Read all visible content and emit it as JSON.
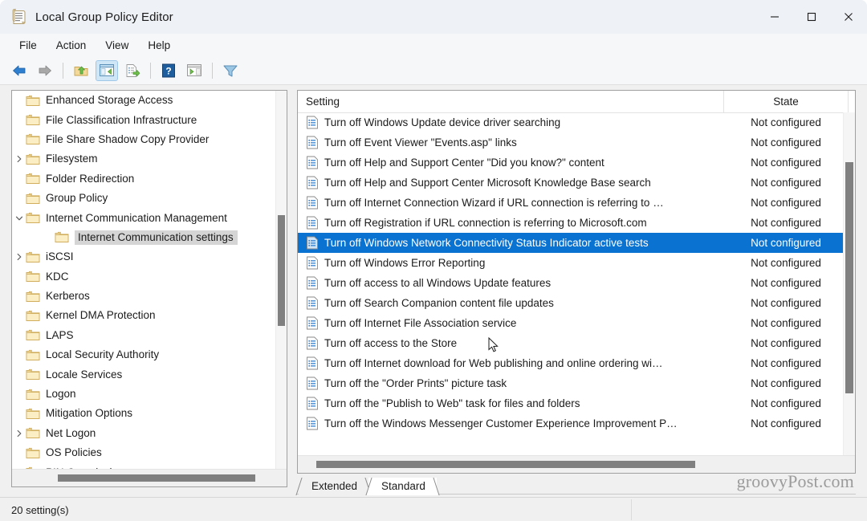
{
  "window": {
    "title": "Local Group Policy Editor",
    "icon": "policy-scroll-icon",
    "controls": {
      "minimize": "─",
      "maximize": "☐",
      "close": "✕"
    }
  },
  "menubar": {
    "items": [
      "File",
      "Action",
      "View",
      "Help"
    ]
  },
  "toolbar": {
    "buttons": [
      {
        "name": "back-icon"
      },
      {
        "name": "forward-icon"
      },
      {
        "sep": true
      },
      {
        "name": "up-one-level-icon"
      },
      {
        "name": "show-hide-console-tree-icon",
        "active": true
      },
      {
        "name": "export-list-icon"
      },
      {
        "sep": true
      },
      {
        "name": "help-icon"
      },
      {
        "name": "show-hide-action-pane-icon"
      },
      {
        "sep": true
      },
      {
        "name": "filter-icon"
      }
    ]
  },
  "tree": {
    "nodes": [
      {
        "label": "Enhanced Storage Access",
        "depth": 1,
        "chevron": "none"
      },
      {
        "label": "File Classification Infrastructure",
        "depth": 1,
        "chevron": "none"
      },
      {
        "label": "File Share Shadow Copy Provider",
        "depth": 1,
        "chevron": "none"
      },
      {
        "label": "Filesystem",
        "depth": 1,
        "chevron": "collapsed"
      },
      {
        "label": "Folder Redirection",
        "depth": 1,
        "chevron": "none"
      },
      {
        "label": "Group Policy",
        "depth": 1,
        "chevron": "none"
      },
      {
        "label": "Internet Communication Management",
        "depth": 1,
        "chevron": "expanded"
      },
      {
        "label": "Internet Communication settings",
        "depth": 2,
        "chevron": "none",
        "selected": true
      },
      {
        "label": "iSCSI",
        "depth": 1,
        "chevron": "collapsed"
      },
      {
        "label": "KDC",
        "depth": 1,
        "chevron": "none"
      },
      {
        "label": "Kerberos",
        "depth": 1,
        "chevron": "none"
      },
      {
        "label": "Kernel DMA Protection",
        "depth": 1,
        "chevron": "none"
      },
      {
        "label": "LAPS",
        "depth": 1,
        "chevron": "none"
      },
      {
        "label": "Local Security Authority",
        "depth": 1,
        "chevron": "none"
      },
      {
        "label": "Locale Services",
        "depth": 1,
        "chevron": "none"
      },
      {
        "label": "Logon",
        "depth": 1,
        "chevron": "none"
      },
      {
        "label": "Mitigation Options",
        "depth": 1,
        "chevron": "none"
      },
      {
        "label": "Net Logon",
        "depth": 1,
        "chevron": "collapsed"
      },
      {
        "label": "OS Policies",
        "depth": 1,
        "chevron": "none"
      },
      {
        "label": "PIN Complexity",
        "depth": 1,
        "chevron": "none"
      }
    ]
  },
  "list": {
    "columns": {
      "setting": "Setting",
      "state": "State"
    },
    "rows": [
      {
        "setting": "Turn off Windows Update device driver searching",
        "state": "Not configured"
      },
      {
        "setting": "Turn off Event Viewer \"Events.asp\" links",
        "state": "Not configured"
      },
      {
        "setting": "Turn off Help and Support Center \"Did you know?\" content",
        "state": "Not configured"
      },
      {
        "setting": "Turn off Help and Support Center Microsoft Knowledge Base search",
        "state": "Not configured"
      },
      {
        "setting": "Turn off Internet Connection Wizard if URL connection is referring to …",
        "state": "Not configured"
      },
      {
        "setting": "Turn off Registration if URL connection is referring to Microsoft.com",
        "state": "Not configured"
      },
      {
        "setting": "Turn off Windows Network Connectivity Status Indicator active tests",
        "state": "Not configured",
        "selected": true
      },
      {
        "setting": "Turn off Windows Error Reporting",
        "state": "Not configured"
      },
      {
        "setting": "Turn off access to all Windows Update features",
        "state": "Not configured"
      },
      {
        "setting": "Turn off Search Companion content file updates",
        "state": "Not configured"
      },
      {
        "setting": "Turn off Internet File Association service",
        "state": "Not configured"
      },
      {
        "setting": "Turn off access to the Store",
        "state": "Not configured"
      },
      {
        "setting": "Turn off Internet download for Web publishing and online ordering wi…",
        "state": "Not configured"
      },
      {
        "setting": "Turn off the \"Order Prints\" picture task",
        "state": "Not configured"
      },
      {
        "setting": "Turn off the \"Publish to Web\" task for files and folders",
        "state": "Not configured"
      },
      {
        "setting": "Turn off the Windows Messenger Customer Experience Improvement P…",
        "state": "Not configured"
      }
    ]
  },
  "tabs": [
    {
      "label": "Extended",
      "active": false
    },
    {
      "label": "Standard",
      "active": true
    }
  ],
  "statusbar": {
    "text": "20 setting(s)"
  },
  "watermark": "groovyPost.com",
  "colors": {
    "selection": "#0a72d1",
    "tree_selection": "#d5d5d5",
    "toolbar_active": "#cfe6f7",
    "window_bg": "#f0f0f0",
    "pane_bg": "#ffffff",
    "scrollbar_thumb": "#808080"
  }
}
